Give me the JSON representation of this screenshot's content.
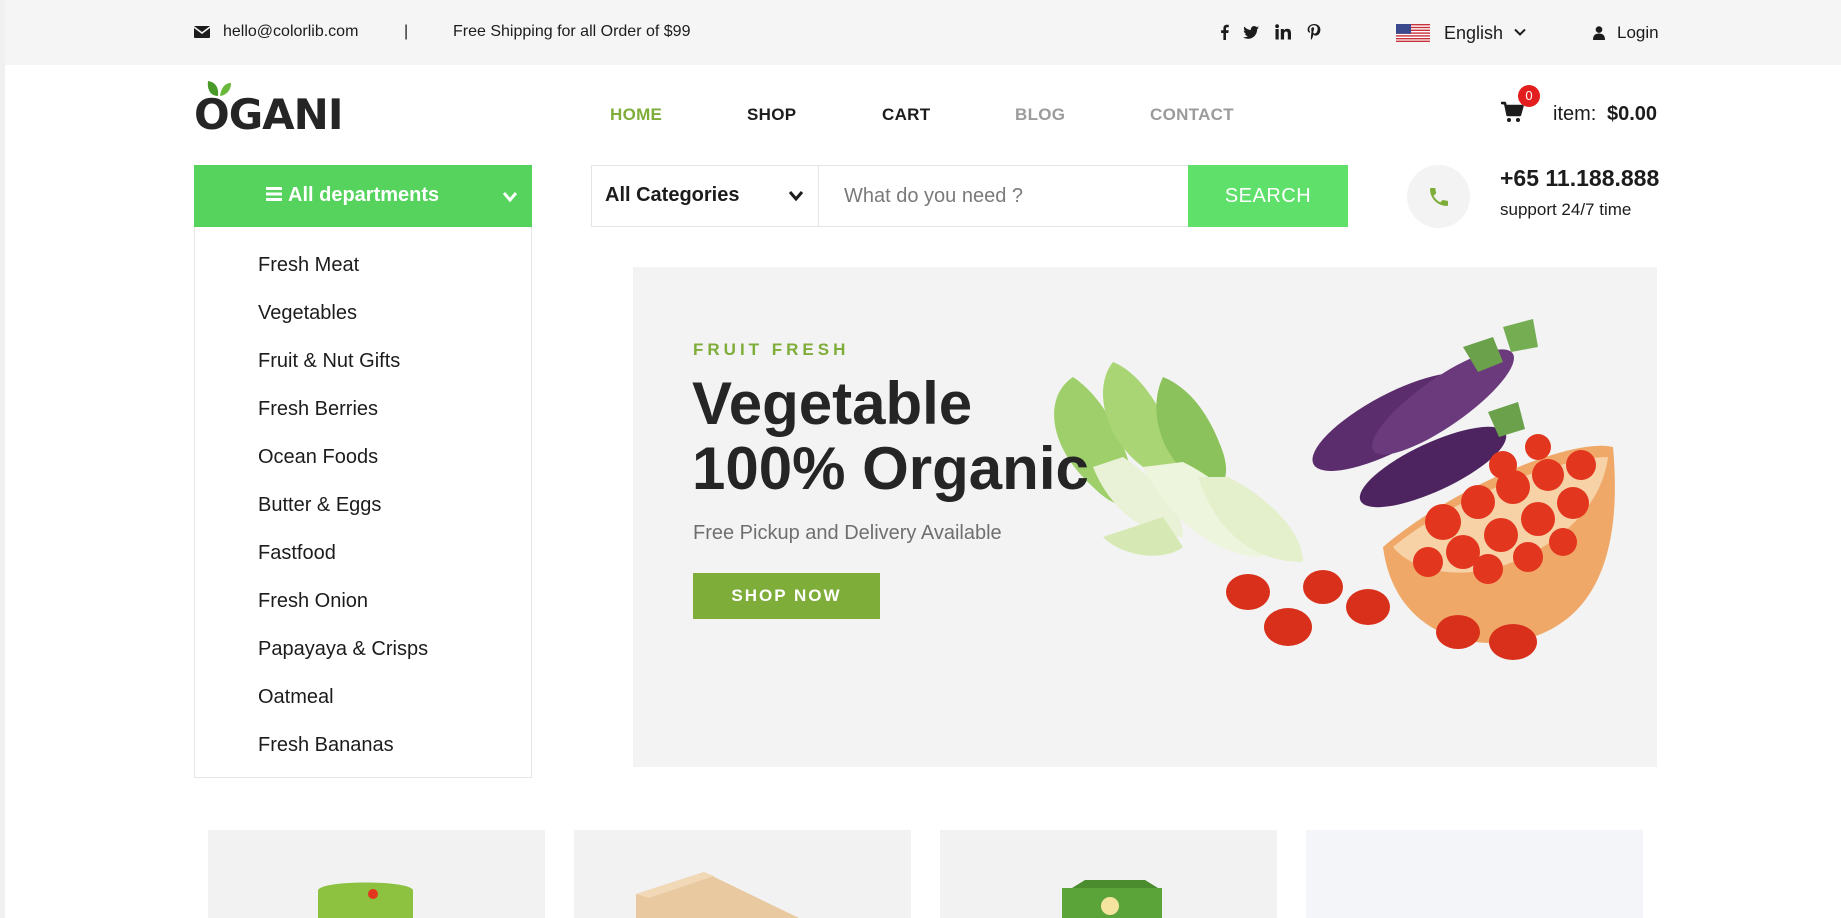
{
  "topbar": {
    "email": "hello@colorlib.com",
    "separator": "|",
    "shipping": "Free Shipping for all Order of $99",
    "social": [
      "facebook-icon",
      "twitter-icon",
      "linkedin-icon",
      "pinterest-icon"
    ],
    "language": "English",
    "login": "Login"
  },
  "logo": {
    "text": "OGANI"
  },
  "nav": {
    "items": [
      {
        "label": "HOME",
        "color": "#7fad39"
      },
      {
        "label": "SHOP",
        "color": "#1c1c1c"
      },
      {
        "label": "CART",
        "color": "#1c1c1c"
      },
      {
        "label": "BLOG",
        "color": "#9b9b9b"
      },
      {
        "label": "CONTACT",
        "color": "#9b9b9b"
      }
    ]
  },
  "cart": {
    "count": "0",
    "item_label": "item:",
    "total": "$0.00"
  },
  "departments": {
    "label": "All departments",
    "items": [
      "Fresh Meat",
      "Vegetables",
      "Fruit & Nut Gifts",
      "Fresh Berries",
      "Ocean Foods",
      "Butter & Eggs",
      "Fastfood",
      "Fresh Onion",
      "Papayaya & Crisps",
      "Oatmeal",
      "Fresh Bananas"
    ]
  },
  "search": {
    "category": "All Categories",
    "placeholder": "What do you need ?",
    "button": "SEARCH"
  },
  "phone": {
    "number": "+65 11.188.888",
    "support": "support 24/7 time"
  },
  "hero": {
    "kicker": "FRUIT FRESH",
    "title_line1": "Vegetable",
    "title_line2": "100% Organic",
    "subtitle": "Free Pickup and Delivery Available",
    "button": "SHOP NOW"
  },
  "colors": {
    "accent": "#7fad39",
    "department_green": "#55d35d",
    "search_green": "#5ee06a",
    "badge_red": "#e31e1e"
  }
}
